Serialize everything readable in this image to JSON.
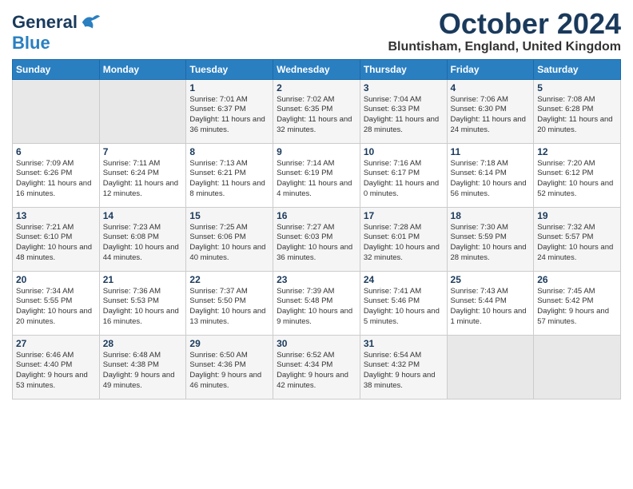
{
  "header": {
    "logo_line1": "General",
    "logo_line2": "Blue",
    "month_title": "October 2024",
    "location": "Bluntisham, England, United Kingdom"
  },
  "days_of_week": [
    "Sunday",
    "Monday",
    "Tuesday",
    "Wednesday",
    "Thursday",
    "Friday",
    "Saturday"
  ],
  "weeks": [
    [
      {
        "day": "",
        "info": ""
      },
      {
        "day": "",
        "info": ""
      },
      {
        "day": "1",
        "info": "Sunrise: 7:01 AM\nSunset: 6:37 PM\nDaylight: 11 hours\nand 36 minutes."
      },
      {
        "day": "2",
        "info": "Sunrise: 7:02 AM\nSunset: 6:35 PM\nDaylight: 11 hours\nand 32 minutes."
      },
      {
        "day": "3",
        "info": "Sunrise: 7:04 AM\nSunset: 6:33 PM\nDaylight: 11 hours\nand 28 minutes."
      },
      {
        "day": "4",
        "info": "Sunrise: 7:06 AM\nSunset: 6:30 PM\nDaylight: 11 hours\nand 24 minutes."
      },
      {
        "day": "5",
        "info": "Sunrise: 7:08 AM\nSunset: 6:28 PM\nDaylight: 11 hours\nand 20 minutes."
      }
    ],
    [
      {
        "day": "6",
        "info": "Sunrise: 7:09 AM\nSunset: 6:26 PM\nDaylight: 11 hours\nand 16 minutes."
      },
      {
        "day": "7",
        "info": "Sunrise: 7:11 AM\nSunset: 6:24 PM\nDaylight: 11 hours\nand 12 minutes."
      },
      {
        "day": "8",
        "info": "Sunrise: 7:13 AM\nSunset: 6:21 PM\nDaylight: 11 hours\nand 8 minutes."
      },
      {
        "day": "9",
        "info": "Sunrise: 7:14 AM\nSunset: 6:19 PM\nDaylight: 11 hours\nand 4 minutes."
      },
      {
        "day": "10",
        "info": "Sunrise: 7:16 AM\nSunset: 6:17 PM\nDaylight: 11 hours\nand 0 minutes."
      },
      {
        "day": "11",
        "info": "Sunrise: 7:18 AM\nSunset: 6:14 PM\nDaylight: 10 hours\nand 56 minutes."
      },
      {
        "day": "12",
        "info": "Sunrise: 7:20 AM\nSunset: 6:12 PM\nDaylight: 10 hours\nand 52 minutes."
      }
    ],
    [
      {
        "day": "13",
        "info": "Sunrise: 7:21 AM\nSunset: 6:10 PM\nDaylight: 10 hours\nand 48 minutes."
      },
      {
        "day": "14",
        "info": "Sunrise: 7:23 AM\nSunset: 6:08 PM\nDaylight: 10 hours\nand 44 minutes."
      },
      {
        "day": "15",
        "info": "Sunrise: 7:25 AM\nSunset: 6:06 PM\nDaylight: 10 hours\nand 40 minutes."
      },
      {
        "day": "16",
        "info": "Sunrise: 7:27 AM\nSunset: 6:03 PM\nDaylight: 10 hours\nand 36 minutes."
      },
      {
        "day": "17",
        "info": "Sunrise: 7:28 AM\nSunset: 6:01 PM\nDaylight: 10 hours\nand 32 minutes."
      },
      {
        "day": "18",
        "info": "Sunrise: 7:30 AM\nSunset: 5:59 PM\nDaylight: 10 hours\nand 28 minutes."
      },
      {
        "day": "19",
        "info": "Sunrise: 7:32 AM\nSunset: 5:57 PM\nDaylight: 10 hours\nand 24 minutes."
      }
    ],
    [
      {
        "day": "20",
        "info": "Sunrise: 7:34 AM\nSunset: 5:55 PM\nDaylight: 10 hours\nand 20 minutes."
      },
      {
        "day": "21",
        "info": "Sunrise: 7:36 AM\nSunset: 5:53 PM\nDaylight: 10 hours\nand 16 minutes."
      },
      {
        "day": "22",
        "info": "Sunrise: 7:37 AM\nSunset: 5:50 PM\nDaylight: 10 hours\nand 13 minutes."
      },
      {
        "day": "23",
        "info": "Sunrise: 7:39 AM\nSunset: 5:48 PM\nDaylight: 10 hours\nand 9 minutes."
      },
      {
        "day": "24",
        "info": "Sunrise: 7:41 AM\nSunset: 5:46 PM\nDaylight: 10 hours\nand 5 minutes."
      },
      {
        "day": "25",
        "info": "Sunrise: 7:43 AM\nSunset: 5:44 PM\nDaylight: 10 hours\nand 1 minute."
      },
      {
        "day": "26",
        "info": "Sunrise: 7:45 AM\nSunset: 5:42 PM\nDaylight: 9 hours\nand 57 minutes."
      }
    ],
    [
      {
        "day": "27",
        "info": "Sunrise: 6:46 AM\nSunset: 4:40 PM\nDaylight: 9 hours\nand 53 minutes."
      },
      {
        "day": "28",
        "info": "Sunrise: 6:48 AM\nSunset: 4:38 PM\nDaylight: 9 hours\nand 49 minutes."
      },
      {
        "day": "29",
        "info": "Sunrise: 6:50 AM\nSunset: 4:36 PM\nDaylight: 9 hours\nand 46 minutes."
      },
      {
        "day": "30",
        "info": "Sunrise: 6:52 AM\nSunset: 4:34 PM\nDaylight: 9 hours\nand 42 minutes."
      },
      {
        "day": "31",
        "info": "Sunrise: 6:54 AM\nSunset: 4:32 PM\nDaylight: 9 hours\nand 38 minutes."
      },
      {
        "day": "",
        "info": ""
      },
      {
        "day": "",
        "info": ""
      }
    ]
  ]
}
